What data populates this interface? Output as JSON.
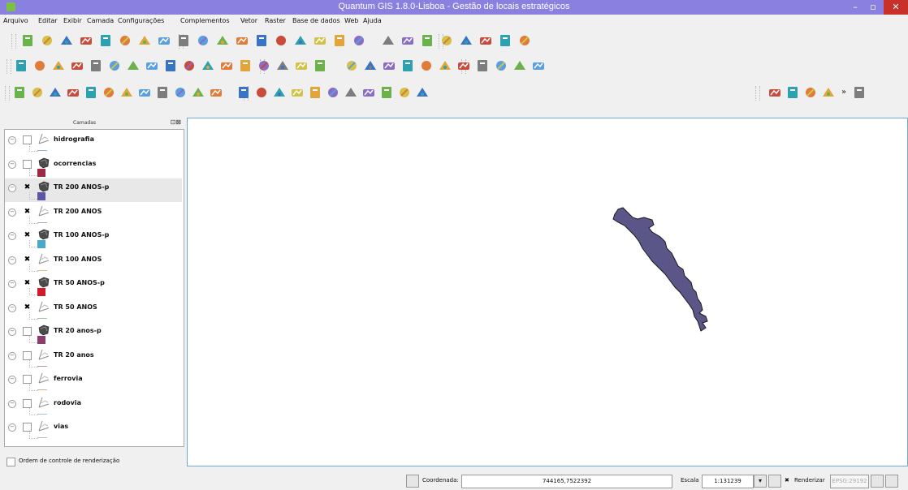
{
  "window": {
    "title": "Quantum GIS 1.8.0-Lisboa - Gestão de locais estratégicos",
    "minimize": "–",
    "maximize": "▫",
    "close": "✕"
  },
  "menu": {
    "items": [
      "Arquivo",
      "Editar",
      "Exibir",
      "Camada",
      "Configurações",
      "Complementos",
      "Vetor",
      "Raster",
      "Base de dados",
      "Web",
      "Ajuda"
    ]
  },
  "layers_panel": {
    "title": "Camadas",
    "buttons": "⊡⊠",
    "layers": [
      {
        "name": "hidrografia",
        "type": "line",
        "checked": false,
        "color": "#9ab0cf"
      },
      {
        "name": "ocorrencias",
        "type": "polygon",
        "checked": false,
        "color": "#9c2a42"
      },
      {
        "name": "TR 200 ANOS-p",
        "type": "polygon",
        "checked": true,
        "color": "#5a56a8"
      },
      {
        "name": "TR 200 ANOS",
        "type": "line",
        "checked": true,
        "color": "#b59ad0"
      },
      {
        "name": "TR 100 ANOS-p",
        "type": "polygon",
        "checked": true,
        "color": "#49a9c8"
      },
      {
        "name": "TR 100 ANOS",
        "type": "line",
        "checked": true,
        "color": "#e2c07a"
      },
      {
        "name": "TR 50 ANOS-p",
        "type": "polygon",
        "checked": true,
        "color": "#d01a2a"
      },
      {
        "name": "TR 50 ANOS",
        "type": "line",
        "checked": true,
        "color": "#a2c9a2"
      },
      {
        "name": "TR 20 anos-p",
        "type": "polygon",
        "checked": false,
        "color": "#8c3d6d"
      },
      {
        "name": "TR 20 anos",
        "type": "line",
        "checked": false,
        "color": "#c98fb2"
      },
      {
        "name": "ferrovia",
        "type": "line",
        "checked": false,
        "color": "#d3b08a"
      },
      {
        "name": "rodovia",
        "type": "line",
        "checked": false,
        "color": "#a7c2d9"
      },
      {
        "name": "vias",
        "type": "line",
        "checked": false,
        "color": "#bcbcbc"
      }
    ],
    "render_order_label": "Ordem de controle de renderização"
  },
  "status": {
    "coord_label": "Coordenada:",
    "coord_value": "744165,7522392",
    "scale_label": "Escala",
    "scale_value": "1:131239",
    "render_label": "Renderizar",
    "epsg": "EPSG:29192"
  },
  "colors": {
    "titlebar": "#8a80df",
    "map_feature": "#5a5688",
    "map_border": "#6ea9d6"
  },
  "icons": {
    "toolbar1": [
      "new-project-icon",
      "open-project-icon",
      "save-project-icon",
      "save-as-icon",
      "print-composer-icon",
      "composer-manager-icon",
      "add-vector-layer-icon",
      "add-raster-layer-icon",
      "add-postgis-layer-icon",
      "add-spatialite-layer-icon",
      "add-mssql-layer-icon",
      "add-wms-layer-icon",
      "add-wcs-layer-icon",
      "add-wfs-layer-icon",
      "new-shapefile-layer-icon",
      "new-spatialite-layer-icon",
      "remove-layer-icon",
      "toggle-editing-icon",
      "save-edits-icon",
      "add-feature-icon",
      "move-feature-icon",
      "node-tool-icon",
      "delete-selected-icon",
      "cut-features-icon",
      "copy-features-icon",
      "paste-features-icon"
    ],
    "toolbar2": [
      "plugin-tool-1-icon",
      "plugin-tool-2-icon",
      "plugin-tool-3-icon",
      "plugin-tool-4-icon",
      "plugin-tool-5-icon",
      "plugin-tool-6-icon",
      "plugin-tool-7-icon",
      "plugin-tool-8-icon",
      "plugin-tool-9-icon",
      "plugin-tool-10-icon",
      "plugin-tool-11-icon",
      "plugin-tool-12-icon",
      "plugin-tool-13-icon",
      "plugin-tool-14-icon",
      "plugin-tool-15-icon",
      "plugin-tool-16-icon",
      "plugin-tool-17-icon",
      "touch-zoom-icon",
      "pan-map-icon",
      "zoom-in-icon",
      "zoom-out-icon",
      "zoom-full-icon",
      "zoom-to-selection-icon",
      "zoom-to-layer-icon",
      "zoom-last-icon",
      "zoom-next-icon",
      "zoom-native-icon",
      "refresh-icon"
    ],
    "toolbar3": [
      "undo-icon",
      "redo-icon",
      "simplify-icon",
      "add-ring-icon",
      "add-part-icon",
      "fill-ring-icon",
      "delete-ring-icon",
      "delete-part-icon",
      "reshape-icon",
      "offset-curve-icon",
      "split-features-icon",
      "merge-features-icon",
      "rotate-label-icon",
      "identify-icon",
      "run-action-icon",
      "select-icon",
      "deselect-icon",
      "open-attribute-table-icon",
      "measure-icon",
      "map-tips-icon",
      "new-bookmark-icon",
      "show-bookmarks-icon",
      "text-annotation-icon",
      "georeferencer-icon",
      "python-console-icon",
      "coordinate-capture-icon",
      "grass-tools-icon",
      "more-tools-icon",
      "collapsed-toolbar-icon"
    ]
  }
}
